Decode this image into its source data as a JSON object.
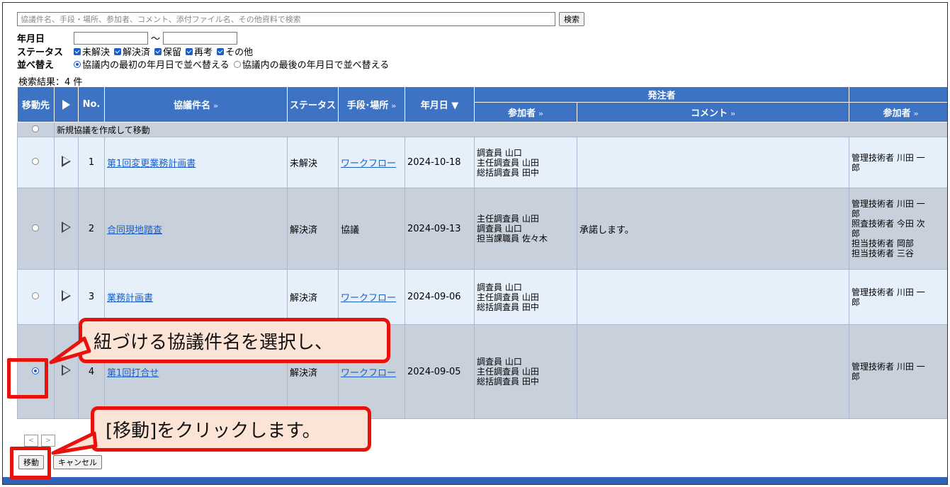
{
  "search": {
    "placeholder": "協議件名、手段・場所、参加者、コメント、添付ファイル名、その他資料で検索",
    "button_label": "検索"
  },
  "filters": {
    "date_label": "年月日",
    "date_sep": "～",
    "status_label": "ステータス",
    "statuses": [
      "未解決",
      "解決済",
      "保留",
      "再考",
      "その他"
    ],
    "sort_label": "並べ替え",
    "sort_options": [
      "協議内の最初の年月日で並べ替える",
      "協議内の最後の年月日で並べ替える"
    ]
  },
  "result_count": "検索結果：4 件",
  "table": {
    "headers": {
      "move_to": "移動先",
      "no": "No.",
      "title": "協議件名",
      "status": "ステータス",
      "method": "手段･場所",
      "date": "年月日 ▼",
      "orderer": "発注者",
      "participants": "参加者",
      "comment": "コメント",
      "participants2": "参加者",
      "more": "»"
    },
    "new_row_label": "新規協議を作成して移動",
    "rows": [
      {
        "no": "1",
        "title": "第1回変更業務計画書",
        "status": "未解決",
        "method": "ワークフロー",
        "method_link": true,
        "date": "2024-10-18",
        "participants": [
          "調査員 山口",
          "主任調査員 山田",
          "総括調査員 田中"
        ],
        "comment": "",
        "managers": [
          "管理技術者 川田 一",
          "郎"
        ],
        "selected": false
      },
      {
        "no": "2",
        "title": "合同現地踏査",
        "status": "解決済",
        "method": "協議",
        "method_link": false,
        "date": "2024-09-13",
        "participants": [
          "主任調査員 山田",
          "調査員 山口",
          "担当課職員 佐々木"
        ],
        "comment": "承諾します。",
        "managers": [
          "管理技術者 川田 一",
          "郎",
          "照査技術者 今田 次",
          "郎",
          "担当技術者 岡部",
          "担当技術者 三谷"
        ],
        "selected": false
      },
      {
        "no": "3",
        "title": "業務計画書",
        "status": "解決済",
        "method": "ワークフロー",
        "method_link": true,
        "date": "2024-09-06",
        "participants": [
          "調査員 山口",
          "主任調査員 山田",
          "総括調査員 田中"
        ],
        "comment": "",
        "managers": [
          "管理技術者 川田 一",
          "郎"
        ],
        "selected": false
      },
      {
        "no": "4",
        "title": "第1回打合せ",
        "status": "解決済",
        "method": "ワークフロー",
        "method_link": true,
        "date": "2024-09-05",
        "participants": [
          "調査員 山口",
          "主任調査員 山田",
          "総括調査員 田中"
        ],
        "comment": "",
        "managers": [
          "管理技術者 川田 一",
          "郎"
        ],
        "selected": true
      }
    ]
  },
  "pager": {
    "prev": "<",
    "next": ">"
  },
  "buttons": {
    "move": "移動",
    "cancel": "キャンセル"
  },
  "callouts": {
    "select": "紐づける協議件名を選択し、",
    "move": "[移動]をクリックします。"
  },
  "colors": {
    "header_bg": "#3e72c2",
    "callout_border": "#e8110c",
    "callout_bg": "#fbe4d6",
    "link": "#1a5fc7"
  }
}
